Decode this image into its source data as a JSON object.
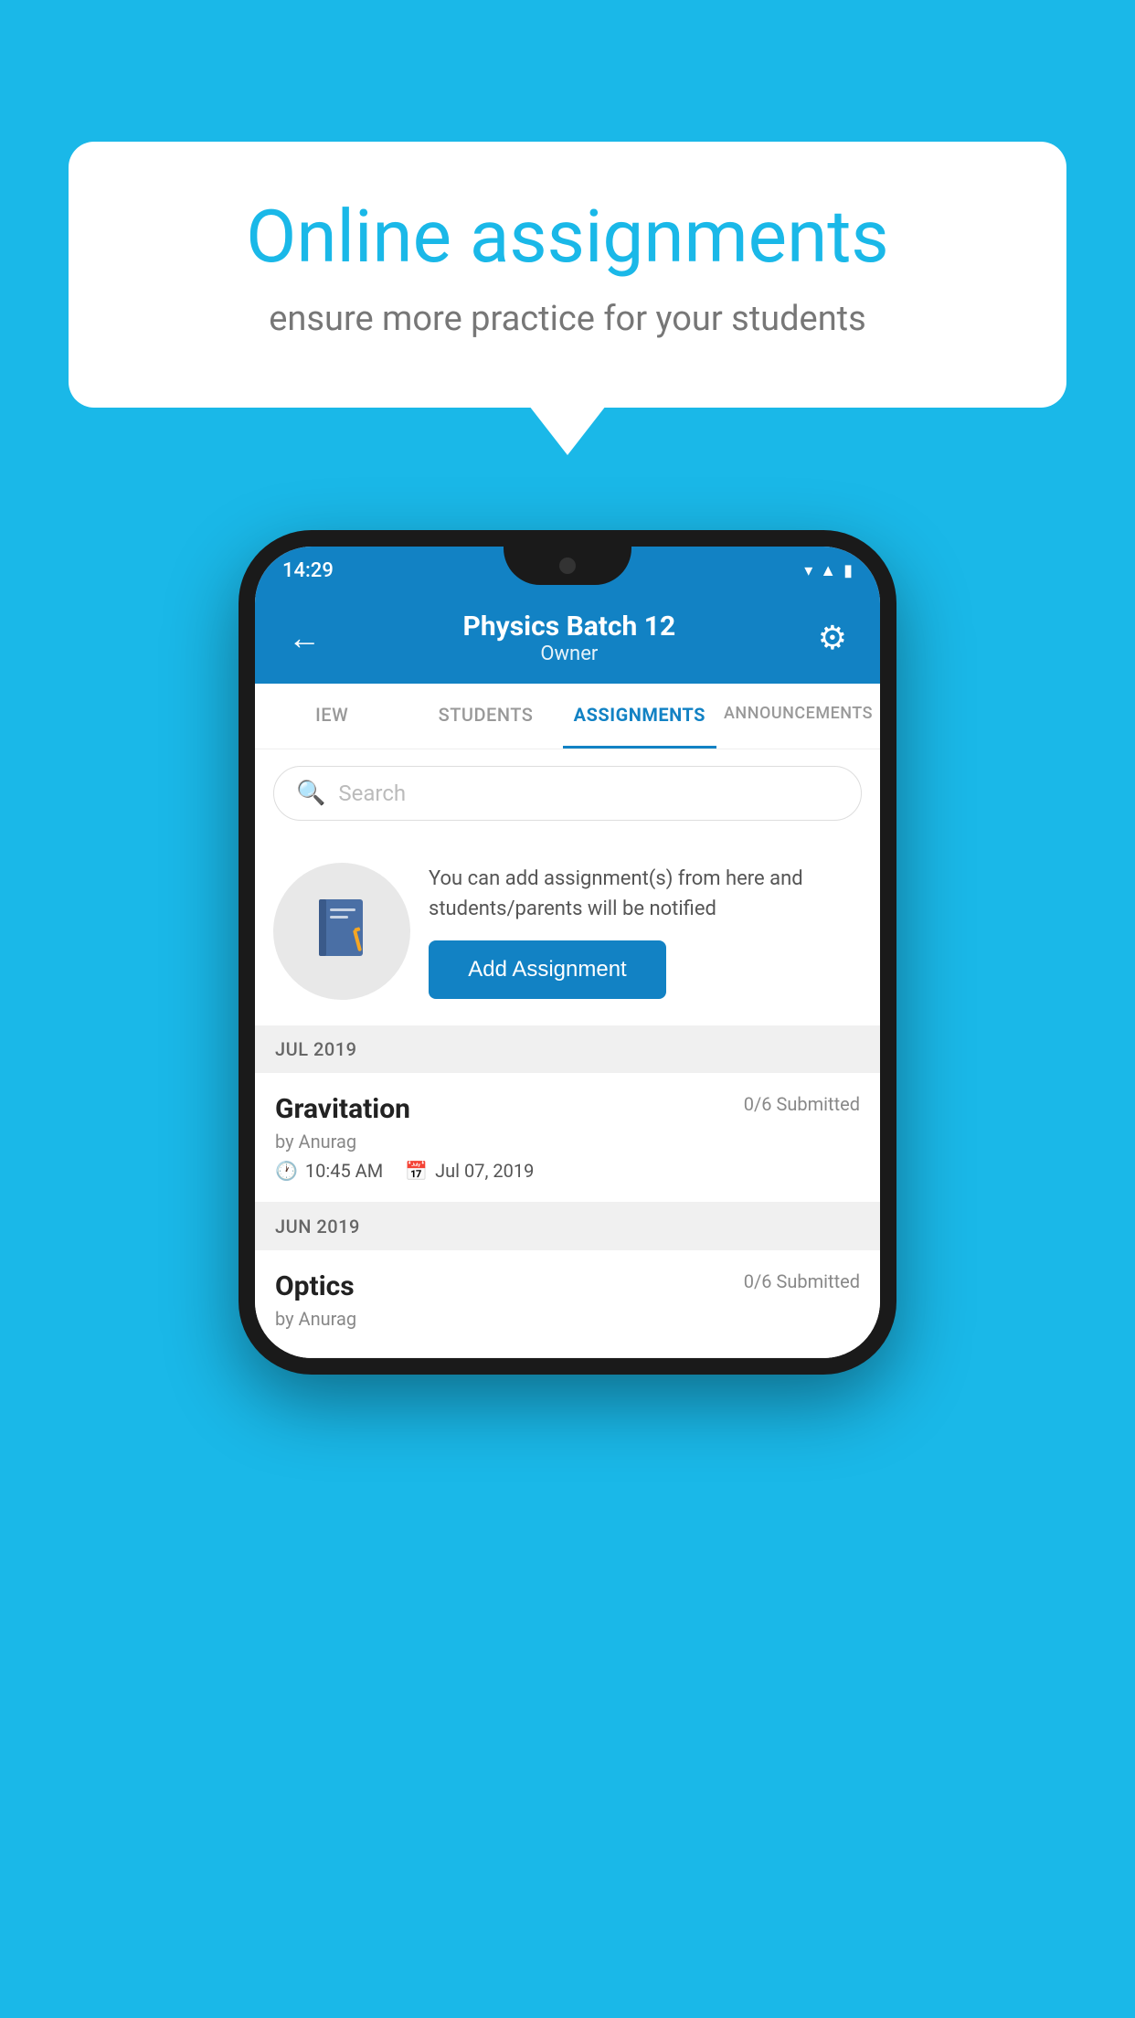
{
  "background_color": "#1ab8e8",
  "speech_bubble": {
    "title": "Online assignments",
    "subtitle": "ensure more practice for your students"
  },
  "status_bar": {
    "time": "14:29",
    "icons": [
      "wifi",
      "signal",
      "battery"
    ]
  },
  "top_bar": {
    "title": "Physics Batch 12",
    "subtitle": "Owner",
    "back_label": "←",
    "settings_label": "⚙"
  },
  "tabs": [
    {
      "label": "IEW",
      "active": false
    },
    {
      "label": "STUDENTS",
      "active": false
    },
    {
      "label": "ASSIGNMENTS",
      "active": true
    },
    {
      "label": "ANNOUNCEMENTS",
      "active": false
    }
  ],
  "search": {
    "placeholder": "Search"
  },
  "assignment_prompt": {
    "info_text": "You can add assignment(s) from here and students/parents will be notified",
    "button_label": "Add Assignment"
  },
  "sections": [
    {
      "label": "JUL 2019",
      "items": [
        {
          "name": "Gravitation",
          "submitted": "0/6 Submitted",
          "by": "by Anurag",
          "time": "10:45 AM",
          "date": "Jul 07, 2019"
        }
      ]
    },
    {
      "label": "JUN 2019",
      "items": [
        {
          "name": "Optics",
          "submitted": "0/6 Submitted",
          "by": "by Anurag",
          "time": "",
          "date": ""
        }
      ]
    }
  ]
}
